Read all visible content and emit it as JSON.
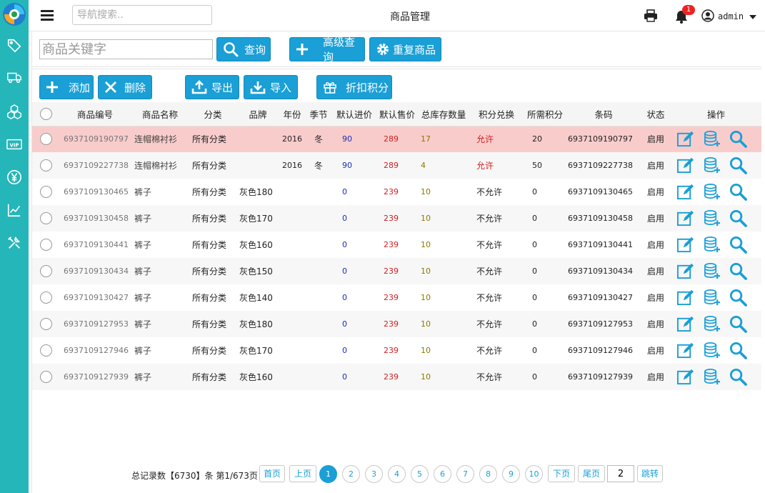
{
  "topbar": {
    "search_placeholder": "导航搜索..",
    "title": "商品管理",
    "notification_count": "1",
    "user": "admin"
  },
  "toolbar": {
    "keyword_placeholder": "商品关键字",
    "query_label": "查询",
    "advanced_label": "高级查询",
    "duplicate_label": "重复商品",
    "add_label": "添加",
    "delete_label": "删除",
    "export_label": "导出",
    "import_label": "导入",
    "discount_label": "折扣积分"
  },
  "table": {
    "headers": [
      "商品编号",
      "商品名称",
      "分类",
      "品牌",
      "年份",
      "季节",
      "默认进价",
      "默认售价",
      "总库存数量",
      "积分兑换",
      "所需积分",
      "条码",
      "状态",
      "操作"
    ],
    "rows": [
      {
        "code": "6937109190797",
        "name": "连帽棉衬衫",
        "category": "所有分类",
        "brand": "",
        "year": "2016",
        "season": "冬",
        "cost": "90",
        "price": "289",
        "stock": "17",
        "points_exchange": "允许",
        "points": "20",
        "barcode": "6937109190797",
        "status": "启用"
      },
      {
        "code": "6937109227738",
        "name": "连帽棉衬衫",
        "category": "所有分类",
        "brand": "",
        "year": "2016",
        "season": "冬",
        "cost": "90",
        "price": "289",
        "stock": "4",
        "points_exchange": "允许",
        "points": "50",
        "barcode": "6937109227738",
        "status": "启用"
      },
      {
        "code": "6937109130465",
        "name": "裤子",
        "category": "所有分类",
        "brand": "灰色180",
        "year": "",
        "season": "",
        "cost": "0",
        "price": "239",
        "stock": "10",
        "points_exchange": "不允许",
        "points": "0",
        "barcode": "6937109130465",
        "status": "启用"
      },
      {
        "code": "6937109130458",
        "name": "裤子",
        "category": "所有分类",
        "brand": "灰色170",
        "year": "",
        "season": "",
        "cost": "0",
        "price": "239",
        "stock": "10",
        "points_exchange": "不允许",
        "points": "0",
        "barcode": "6937109130458",
        "status": "启用"
      },
      {
        "code": "6937109130441",
        "name": "裤子",
        "category": "所有分类",
        "brand": "灰色160",
        "year": "",
        "season": "",
        "cost": "0",
        "price": "239",
        "stock": "10",
        "points_exchange": "不允许",
        "points": "0",
        "barcode": "6937109130441",
        "status": "启用"
      },
      {
        "code": "6937109130434",
        "name": "裤子",
        "category": "所有分类",
        "brand": "灰色150",
        "year": "",
        "season": "",
        "cost": "0",
        "price": "239",
        "stock": "10",
        "points_exchange": "不允许",
        "points": "0",
        "barcode": "6937109130434",
        "status": "启用"
      },
      {
        "code": "6937109130427",
        "name": "裤子",
        "category": "所有分类",
        "brand": "灰色140",
        "year": "",
        "season": "",
        "cost": "0",
        "price": "239",
        "stock": "10",
        "points_exchange": "不允许",
        "points": "0",
        "barcode": "6937109130427",
        "status": "启用"
      },
      {
        "code": "6937109127953",
        "name": "裤子",
        "category": "所有分类",
        "brand": "灰色180",
        "year": "",
        "season": "",
        "cost": "0",
        "price": "239",
        "stock": "10",
        "points_exchange": "不允许",
        "points": "0",
        "barcode": "6937109127953",
        "status": "启用"
      },
      {
        "code": "6937109127946",
        "name": "裤子",
        "category": "所有分类",
        "brand": "灰色170",
        "year": "",
        "season": "",
        "cost": "0",
        "price": "239",
        "stock": "10",
        "points_exchange": "不允许",
        "points": "0",
        "barcode": "6937109127946",
        "status": "启用"
      },
      {
        "code": "6937109127939",
        "name": "裤子",
        "category": "所有分类",
        "brand": "灰色160",
        "year": "",
        "season": "",
        "cost": "0",
        "price": "239",
        "stock": "10",
        "points_exchange": "不允许",
        "points": "0",
        "barcode": "6937109127939",
        "status": "启用"
      }
    ]
  },
  "pagination": {
    "summary": "总记录数【6730】条 第1/673页",
    "first": "首页",
    "prev": "上页",
    "pages": [
      "1",
      "2",
      "3",
      "4",
      "5",
      "6",
      "7",
      "8",
      "9",
      "10"
    ],
    "current": "1",
    "next": "下页",
    "last": "尾页",
    "jump_value": "2",
    "jump_label": "跳转"
  },
  "sidebar": {
    "icons": [
      "tag-icon",
      "truck-icon",
      "boxes-icon",
      "vip-icon",
      "yen-icon",
      "chart-icon",
      "tools-icon"
    ]
  },
  "colors": {
    "sidebar": "#24b6b9",
    "accent": "#1a9fd6",
    "highlight_row": "#f9cccc",
    "allow_text": "#d21f1f"
  }
}
